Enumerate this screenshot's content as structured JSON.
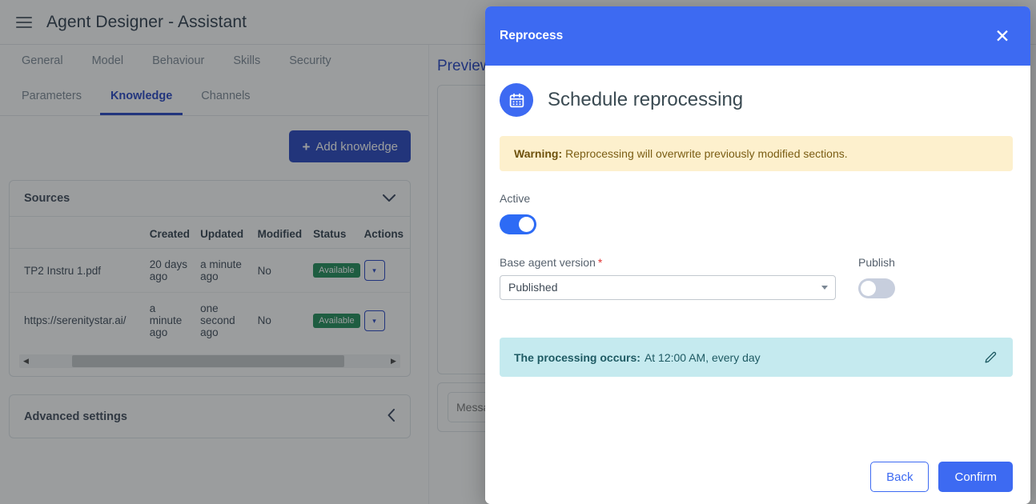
{
  "app": {
    "title": "Agent Designer - Assistant",
    "menu_icon": "hamburger-icon",
    "topbar_buttons": [
      {
        "label": ""
      },
      {
        "label": ""
      }
    ],
    "primary_tabs": [
      {
        "label": "General",
        "active": false
      },
      {
        "label": "Model",
        "active": false
      },
      {
        "label": "Behaviour",
        "active": false
      },
      {
        "label": "Skills",
        "active": false
      },
      {
        "label": "Security",
        "active": false
      }
    ],
    "secondary_tabs": [
      {
        "label": "Parameters",
        "active": false
      },
      {
        "label": "Knowledge",
        "active": true
      },
      {
        "label": "Channels",
        "active": false
      }
    ],
    "add_knowledge_button": "Add knowledge",
    "sources_card": {
      "title": "Sources",
      "collapse_icon": "chevron-down-icon",
      "columns": [
        "",
        "Created",
        "Updated",
        "Modified",
        "Status",
        "Actions"
      ],
      "rows": [
        {
          "name": "TP2 Instru 1.pdf",
          "created": "20 days ago",
          "updated": "a minute ago",
          "modified": "No",
          "status": "Available",
          "action_icon": "chevron-down-icon"
        },
        {
          "name": "https://serenitystar.ai/",
          "created": "a minute ago",
          "updated": "one second ago",
          "modified": "No",
          "status": "Available",
          "action_icon": "chevron-down-icon"
        }
      ],
      "scroll_left_icon": "arrow-left-icon",
      "scroll_right_icon": "arrow-right-icon"
    },
    "advanced_settings": {
      "title": "Advanced settings",
      "collapse_icon": "chevron-left-icon"
    },
    "preview": {
      "title": "Preview",
      "message_placeholder": "Message"
    }
  },
  "modal": {
    "header_title": "Reprocess",
    "close_icon": "close-icon",
    "calendar_icon": "calendar-icon",
    "heading": "Schedule reprocessing",
    "warning_label": "Warning:",
    "warning_text": "Reprocessing will overwrite previously modified sections.",
    "active_label": "Active",
    "active_on": true,
    "base_version_label": "Base agent version",
    "base_version_required": "*",
    "base_version_value": "Published",
    "base_version_options": [
      "Published"
    ],
    "publish_label": "Publish",
    "publish_on": false,
    "info_label": "The processing occurs:",
    "info_value": "At 12:00 AM, every day",
    "edit_icon": "pencil-icon",
    "back_button": "Back",
    "confirm_button": "Confirm"
  },
  "colors": {
    "brand_blue": "#2343c0",
    "modal_blue": "#3d6af2",
    "warning_bg": "#fdf0cd",
    "info_bg": "#c5eaef",
    "badge_green": "#1d8a56",
    "required_red": "#e03131"
  }
}
